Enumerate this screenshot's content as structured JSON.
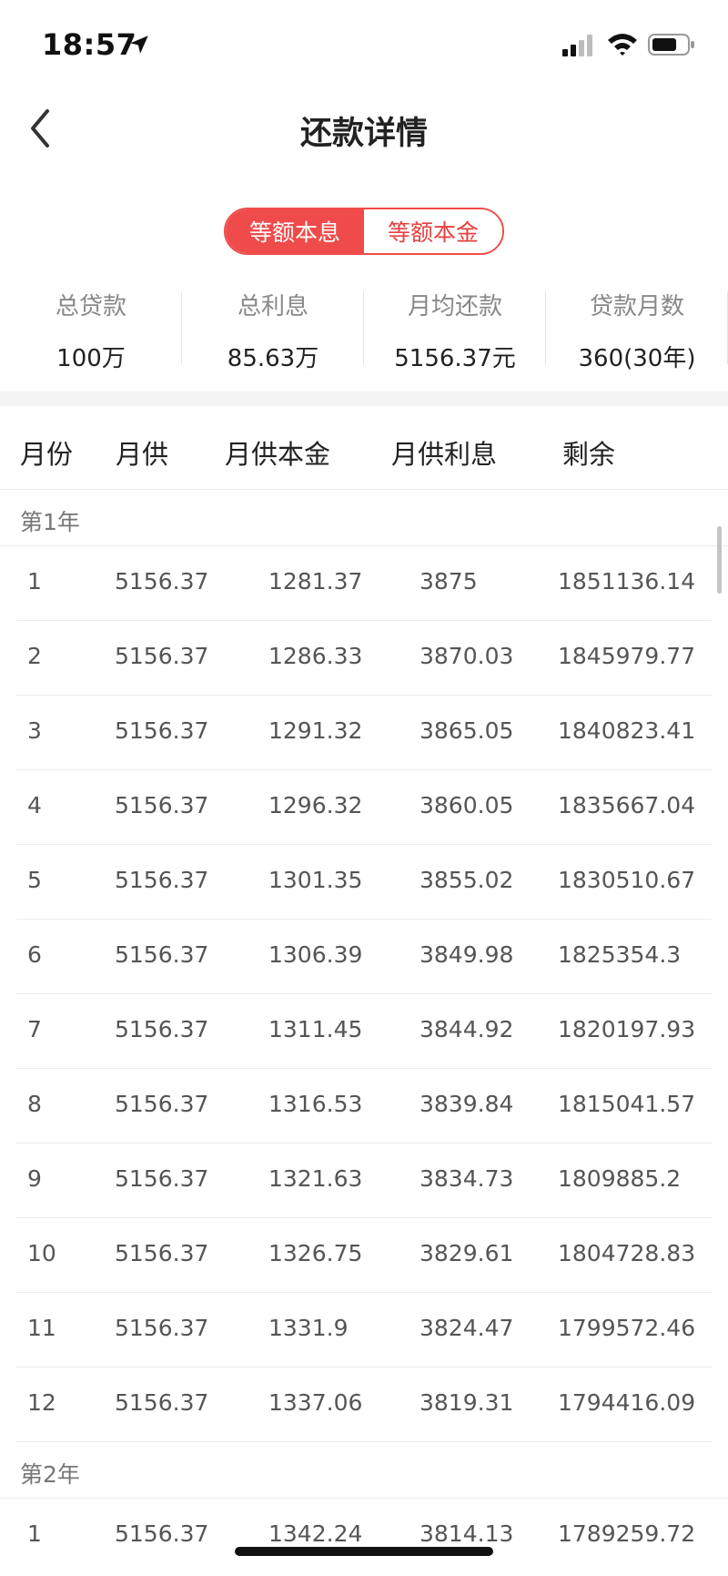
{
  "status_bar": {
    "time": "18:57",
    "icons": [
      "location-arrow-icon",
      "cellular-signal-icon",
      "wifi-icon",
      "battery-icon"
    ]
  },
  "nav": {
    "title": "还款详情",
    "back_icon": "chevron-left-icon"
  },
  "segments": [
    {
      "label": "等额本息",
      "active": true
    },
    {
      "label": "等额本金",
      "active": false
    }
  ],
  "summary": [
    {
      "label": "总贷款",
      "value": "100万"
    },
    {
      "label": "总利息",
      "value": "85.63万"
    },
    {
      "label": "月均还款",
      "value": "5156.37元"
    },
    {
      "label": "贷款月数",
      "value": "360(30年)"
    }
  ],
  "table": {
    "headers": [
      "月份",
      "月供",
      "月供本金",
      "月供利息",
      "剩余"
    ],
    "groups": [
      {
        "year_label": "第1年",
        "rows": [
          [
            "1",
            "5156.37",
            "1281.37",
            "3875",
            "1851136.14"
          ],
          [
            "2",
            "5156.37",
            "1286.33",
            "3870.03",
            "1845979.77"
          ],
          [
            "3",
            "5156.37",
            "1291.32",
            "3865.05",
            "1840823.41"
          ],
          [
            "4",
            "5156.37",
            "1296.32",
            "3860.05",
            "1835667.04"
          ],
          [
            "5",
            "5156.37",
            "1301.35",
            "3855.02",
            "1830510.67"
          ],
          [
            "6",
            "5156.37",
            "1306.39",
            "3849.98",
            "1825354.3"
          ],
          [
            "7",
            "5156.37",
            "1311.45",
            "3844.92",
            "1820197.93"
          ],
          [
            "8",
            "5156.37",
            "1316.53",
            "3839.84",
            "1815041.57"
          ],
          [
            "9",
            "5156.37",
            "1321.63",
            "3834.73",
            "1809885.2"
          ],
          [
            "10",
            "5156.37",
            "1326.75",
            "3829.61",
            "1804728.83"
          ],
          [
            "11",
            "5156.37",
            "1331.9",
            "3824.47",
            "1799572.46"
          ],
          [
            "12",
            "5156.37",
            "1337.06",
            "3819.31",
            "1794416.09"
          ]
        ]
      },
      {
        "year_label": "第2年",
        "rows": [
          [
            "1",
            "5156.37",
            "1342.24",
            "3814.13",
            "1789259.72"
          ]
        ]
      }
    ]
  },
  "colors": {
    "accent": "#f04b4b",
    "divider": "#ececec",
    "label_gray": "#888888"
  }
}
